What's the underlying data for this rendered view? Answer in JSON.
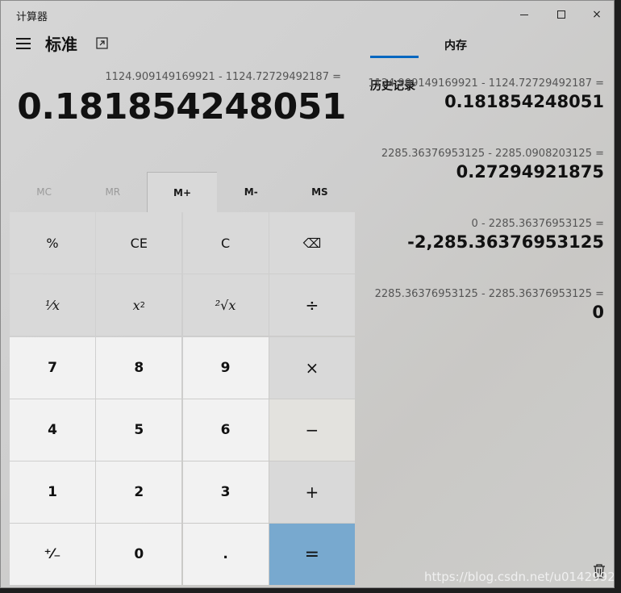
{
  "app": {
    "title": "计算器"
  },
  "window_controls": {
    "minimize": "minimize",
    "maximize": "maximize",
    "close": "×"
  },
  "header": {
    "mode": "标准"
  },
  "display": {
    "expression": "1124.909149169921 - 1124.72729492187 =",
    "value": "0.181854248051"
  },
  "memory": {
    "buttons": [
      "MC",
      "MR",
      "M+",
      "M-",
      "MS"
    ]
  },
  "keypad": {
    "percent": "%",
    "ce": "CE",
    "clear": "C",
    "backspace": "⌫",
    "reciprocal": "¹⁄x",
    "square_base": "x",
    "square_exp": "2",
    "sqrt": "²√x",
    "divide": "÷",
    "seven": "7",
    "eight": "8",
    "nine": "9",
    "multiply": "×",
    "four": "4",
    "five": "5",
    "six": "6",
    "minus": "−",
    "one": "1",
    "two": "2",
    "three": "3",
    "plus": "+",
    "negate": "⁺⁄₋",
    "zero": "0",
    "decimal": ".",
    "equals": "="
  },
  "panel": {
    "tabs": [
      "历史记录",
      "内存"
    ],
    "history": [
      {
        "expr": "1124.909149169921   -   1124.72729492187 =",
        "result": "0.181854248051"
      },
      {
        "expr": "2285.36376953125   -   2285.0908203125 =",
        "result": "0.27294921875"
      },
      {
        "expr": "0   -   2285.36376953125 =",
        "result": "-2,285.36376953125"
      },
      {
        "expr": "2285.36376953125   -   2285.36376953125 =",
        "result": "0"
      }
    ]
  },
  "watermark": "https://blog.csdn.net/u014299266",
  "colors": {
    "accent": "#0067c0",
    "equals": "#78a9cf"
  },
  "icons": {
    "menu": "hamburger-icon",
    "keep_on_top": "keep-on-top-icon",
    "trash": "trash-icon"
  }
}
